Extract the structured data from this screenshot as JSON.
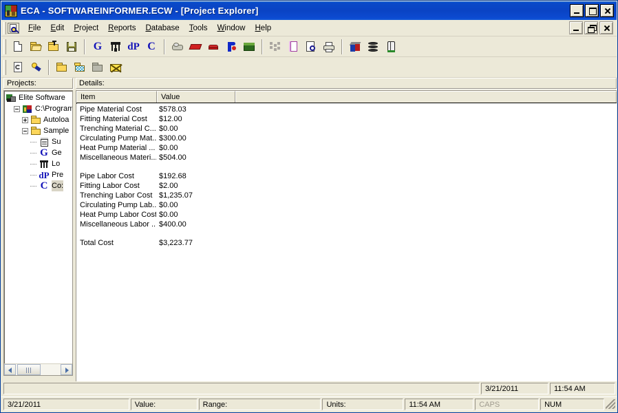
{
  "window": {
    "title": "ECA - SOFTWAREINFORMER.ECW - [Project Explorer]",
    "app_icon": "application-icon",
    "controls": {
      "minimize": "minimize-button",
      "maximize": "maximize-button",
      "close": "close-button"
    }
  },
  "mdi_controls": {
    "minimize": "mdi-minimize-button",
    "restore": "mdi-restore-button",
    "close": "mdi-close-button"
  },
  "menubar": {
    "sys_icon": "document-search-icon",
    "items": [
      {
        "label": "File",
        "accel": "F"
      },
      {
        "label": "Edit",
        "accel": "E"
      },
      {
        "label": "Project",
        "accel": "P"
      },
      {
        "label": "Reports",
        "accel": "R"
      },
      {
        "label": "Database",
        "accel": "D"
      },
      {
        "label": "Tools",
        "accel": "T"
      },
      {
        "label": "Window",
        "accel": "W"
      },
      {
        "label": "Help",
        "accel": "H"
      }
    ]
  },
  "toolbar_primary": [
    {
      "name": "new-file-button",
      "icon": "new-document-icon"
    },
    {
      "name": "open-file-button",
      "icon": "open-folder-icon"
    },
    {
      "name": "open-project-button",
      "icon": "folder-up-arrow-icon"
    },
    {
      "name": "save-button",
      "icon": "floppy-disk-icon"
    },
    {
      "name": "separator-1",
      "icon": "separator"
    },
    {
      "name": "g-program-button",
      "icon": "letter-g-icon"
    },
    {
      "name": "duct-program-button",
      "icon": "duct-icon"
    },
    {
      "name": "dp-program-button",
      "icon": "letters-dp-icon"
    },
    {
      "name": "c-program-button",
      "icon": "letter-c-icon"
    },
    {
      "name": "separator-2",
      "icon": "separator"
    },
    {
      "name": "water-program-button",
      "icon": "cloud-water-icon"
    },
    {
      "name": "radiant-program-button",
      "icon": "red-panel-icon"
    },
    {
      "name": "boiler-program-button",
      "icon": "red-boiler-icon"
    },
    {
      "name": "pipe-program-button",
      "icon": "blue-pipe-icon"
    },
    {
      "name": "ground-loop-program-button",
      "icon": "green-earth-icon"
    },
    {
      "name": "separator-3",
      "icon": "separator"
    },
    {
      "name": "layout-button",
      "icon": "dotted-layout-icon"
    },
    {
      "name": "report-window-button",
      "icon": "report-page-icon"
    },
    {
      "name": "print-preview-button",
      "icon": "print-preview-icon"
    },
    {
      "name": "print-button",
      "icon": "printer-icon"
    },
    {
      "name": "separator-4",
      "icon": "separator"
    },
    {
      "name": "three-d-view-button",
      "icon": "cube-icon"
    },
    {
      "name": "database-button",
      "icon": "database-stack-icon"
    },
    {
      "name": "tank-button",
      "icon": "cylinder-tank-icon"
    }
  ],
  "toolbar_secondary": [
    {
      "name": "refresh-button",
      "icon": "refresh-document-icon"
    },
    {
      "name": "find-button",
      "icon": "flashlight-icon"
    },
    {
      "name": "separator-5",
      "icon": "separator"
    },
    {
      "name": "open-folder-button",
      "icon": "yellow-folder-icon"
    },
    {
      "name": "new-folder-button",
      "icon": "checkered-folder-icon"
    },
    {
      "name": "archive-folder-button",
      "icon": "grey-folder-icon"
    },
    {
      "name": "delete-mail-button",
      "icon": "envelope-x-icon"
    }
  ],
  "projects_panel": {
    "label": "Projects:",
    "tree": [
      {
        "label": "Elite Software",
        "indent": 0,
        "expander": "none",
        "icon": "machine-icon",
        "selected": false
      },
      {
        "label": "C:\\Program",
        "indent": 1,
        "expander": "minus",
        "icon": "project-icon",
        "selected": false
      },
      {
        "label": "Autoloa",
        "indent": 2,
        "expander": "plus",
        "icon": "folder-icon",
        "selected": false
      },
      {
        "label": "Sample",
        "indent": 2,
        "expander": "minus",
        "icon": "folder-icon",
        "selected": false
      },
      {
        "label": "Su",
        "indent": 3,
        "expander": "none",
        "icon": "report-notepad-icon",
        "selected": false
      },
      {
        "label": "Ge",
        "indent": 3,
        "expander": "none",
        "icon": "letter-g-icon",
        "selected": false
      },
      {
        "label": "Lo",
        "indent": 3,
        "expander": "none",
        "icon": "duct-icon",
        "selected": false
      },
      {
        "label": "Pre",
        "indent": 3,
        "expander": "none",
        "icon": "letters-dp-icon",
        "selected": false
      },
      {
        "label": "Co:",
        "indent": 3,
        "expander": "none",
        "icon": "letter-c-icon",
        "selected": true
      }
    ],
    "hscroll": {
      "left_arrow": "scroll-left-arrow",
      "right_arrow": "scroll-right-arrow",
      "thumb": "scroll-thumb"
    }
  },
  "details_panel": {
    "label": "Details:",
    "columns": [
      "Item",
      "Value",
      ""
    ],
    "rows": [
      {
        "item": "Pipe Material Cost",
        "value": "$578.03"
      },
      {
        "item": "Fitting Material Cost",
        "value": "$12.00"
      },
      {
        "item": "Trenching Material C...",
        "value": "$0.00"
      },
      {
        "item": "Circulating Pump Mat...",
        "value": "$300.00"
      },
      {
        "item": "Heat Pump Material ...",
        "value": "$0.00"
      },
      {
        "item": "Miscellaneous Materi...",
        "value": "$504.00"
      },
      {
        "item": "",
        "value": ""
      },
      {
        "item": "Pipe Labor Cost",
        "value": "$192.68"
      },
      {
        "item": "Fitting Labor Cost",
        "value": "$2.00"
      },
      {
        "item": "Trenching Labor Cost",
        "value": "$1,235.07"
      },
      {
        "item": "Circulating Pump Lab...",
        "value": "$0.00"
      },
      {
        "item": "Heat Pump Labor Cost",
        "value": "$0.00"
      },
      {
        "item": "Miscellaneous Labor ...",
        "value": "$400.00"
      },
      {
        "item": "",
        "value": ""
      },
      {
        "item": "Total Cost",
        "value": "$3,223.77"
      }
    ]
  },
  "status_upper": {
    "main": "",
    "date": "3/21/2011",
    "time": "11:54 AM"
  },
  "status_lower": {
    "date": "3/21/2011",
    "value_label": "Value:",
    "range_label": "Range:",
    "units_label": "Units:",
    "time": "11:54 AM",
    "caps": "CAPS",
    "num": "NUM"
  },
  "colors": {
    "titlebar": "#0a46c8",
    "face": "#ece9d8",
    "accent_blue": "#1212b8"
  }
}
